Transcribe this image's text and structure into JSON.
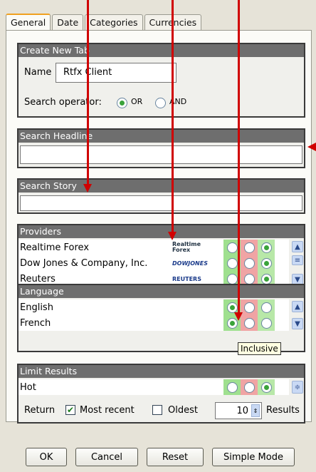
{
  "tabs": [
    {
      "label": "General"
    },
    {
      "label": "Date"
    },
    {
      "label": "Categories"
    },
    {
      "label": "Currencies"
    }
  ],
  "create_tab": {
    "header": "Create New Tab",
    "name_label": "Name",
    "name_value": "Rtfx Client",
    "search_operator_label": "Search operator:",
    "or_label": "OR",
    "and_label": "AND"
  },
  "search_headline": {
    "header": "Search Headline",
    "value": ""
  },
  "search_story": {
    "header": "Search Story",
    "value": ""
  },
  "providers": {
    "header": "Providers",
    "items": [
      {
        "name": "Realtime Forex",
        "logo": "Realtime Forex",
        "logo_line2": "Forex",
        "logo_line1": "Realtime"
      },
      {
        "name": "Dow Jones & Company, Inc.",
        "logo": "DOWJONES"
      },
      {
        "name": "Reuters",
        "logo": "REUTERS"
      }
    ]
  },
  "language": {
    "header": "Language",
    "items": [
      {
        "name": "English"
      },
      {
        "name": "French"
      }
    ],
    "tooltip": "Inclusive"
  },
  "limit_results": {
    "header": "Limit Results",
    "items": [
      {
        "name": "Hot"
      }
    ],
    "return_label": "Return",
    "most_recent_label": "Most recent",
    "oldest_label": "Oldest",
    "count_value": "10",
    "results_label": "Results"
  },
  "buttons": {
    "ok": "OK",
    "cancel": "Cancel",
    "reset": "Reset",
    "simple_mode": "Simple Mode"
  },
  "colors": {
    "annotation_arrow": "#d00000",
    "group_header": "#6e6e6e",
    "include_cell": "#9fe08f",
    "exclude_cell": "#f0a4a4"
  }
}
